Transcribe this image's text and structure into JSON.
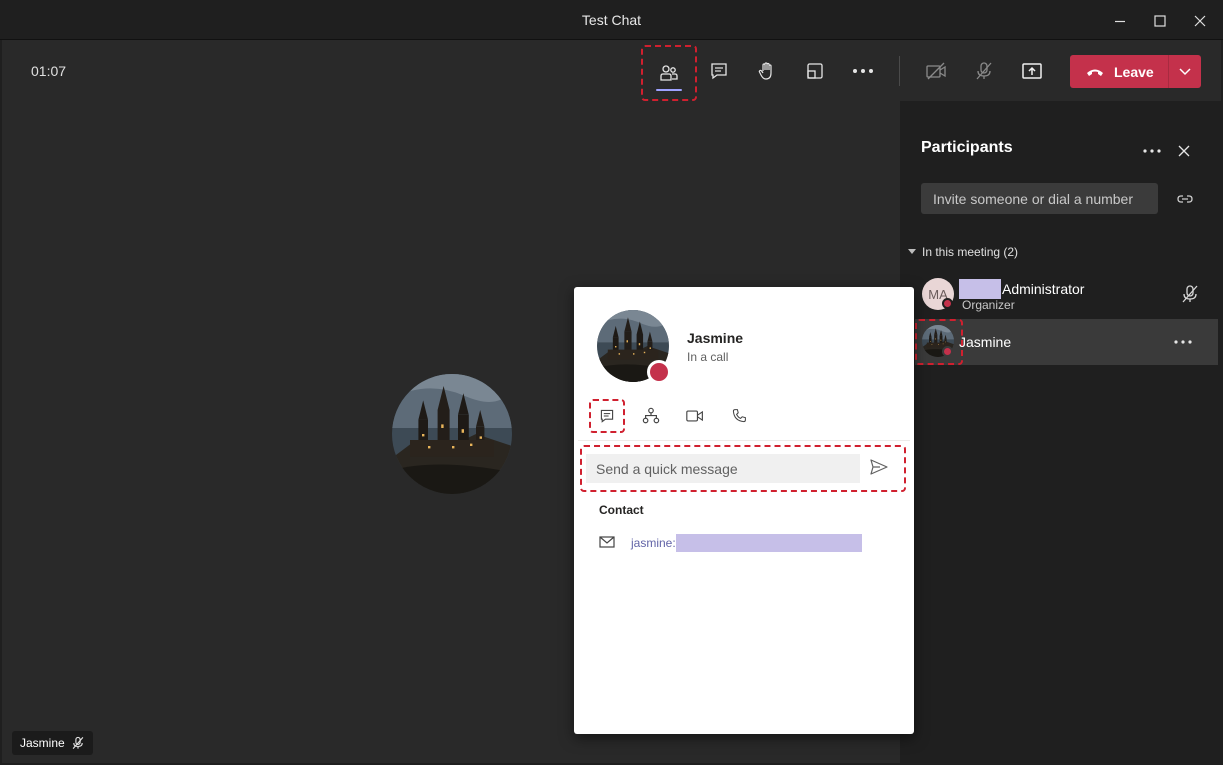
{
  "window": {
    "title": "Test Chat"
  },
  "toolbar": {
    "timer": "01:07",
    "leave_label": "Leave"
  },
  "stage": {
    "name_tag": "Jasmine"
  },
  "participants": {
    "title": "Participants",
    "invite_placeholder": "Invite someone or dial a number",
    "section_label": "In this meeting (2)",
    "people": [
      {
        "initials": "MA",
        "name": "Administrator",
        "role": "Organizer"
      },
      {
        "name": "Jasmine"
      }
    ]
  },
  "card": {
    "name": "Jasmine",
    "status": "In a call",
    "quick_message_placeholder": "Send a quick message",
    "contact_heading": "Contact",
    "email_prefix": "jasmine:"
  },
  "colors": {
    "accent": "#6264a7",
    "leave": "#c4314b",
    "busy_dot": "#c4314b",
    "highlight": "#d0202f"
  }
}
